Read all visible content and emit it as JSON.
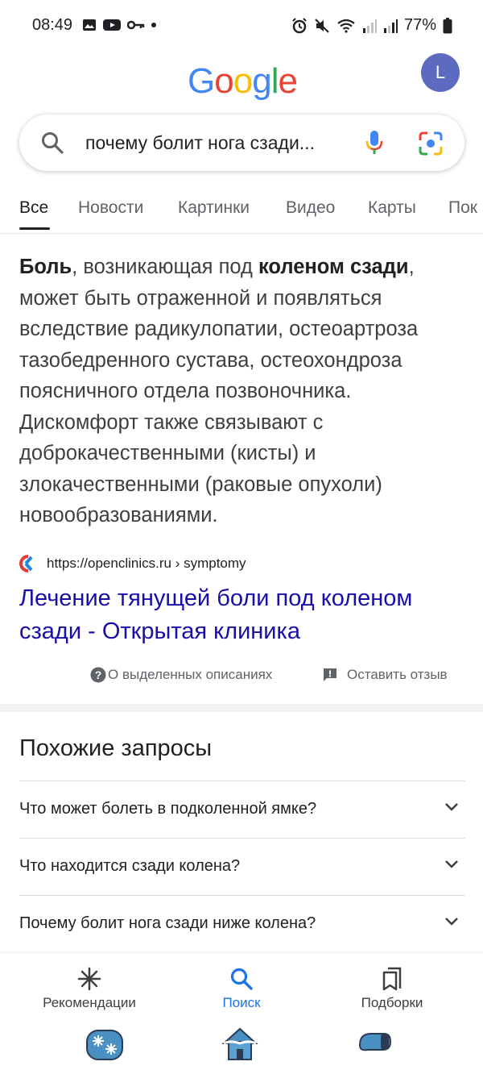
{
  "status_bar": {
    "time": "08:49",
    "battery": "77%"
  },
  "header": {
    "logo": "Google",
    "avatar_letter": "L"
  },
  "search": {
    "query": "почему болит нога сзади..."
  },
  "tabs": [
    {
      "label": "Все"
    },
    {
      "label": "Новости"
    },
    {
      "label": "Картинки"
    },
    {
      "label": "Видео"
    },
    {
      "label": "Карты"
    },
    {
      "label": "Пок"
    }
  ],
  "snippet": {
    "bold_1": "Боль",
    "text_1": ", возникающая под ",
    "bold_2": "коленом сзади",
    "text_2": ", может быть отраженной и появляться вследствие радикулопатии, остеоартроза тазобедренного сустава, остеохондроза поясничного отдела позвоночника. Дискомфорт также связывают с доброкачественными (кисты) и злокачественными (раковые опухоли) новообразованиями.",
    "source_url": "https://openclinics.ru › symptomy",
    "result_title": "Лечение тянущей боли под коленом сзади - Открытая клиника",
    "about_label": "О выделенных описаниях",
    "feedback_label": "Оставить отзыв"
  },
  "related": {
    "title": "Похожие запросы",
    "items": [
      {
        "label": "Что может болеть в подколенной ямке?"
      },
      {
        "label": "Что находится сзади колена?"
      },
      {
        "label": "Почему болит нога сзади ниже колена?"
      }
    ]
  },
  "bottom_nav": {
    "items": [
      {
        "label": "Рекомендации"
      },
      {
        "label": "Поиск"
      },
      {
        "label": "Подборки"
      }
    ]
  },
  "colors": {
    "link": "#1a0dab",
    "accent": "#1a73e8",
    "avatar": "#5c6bc0"
  }
}
